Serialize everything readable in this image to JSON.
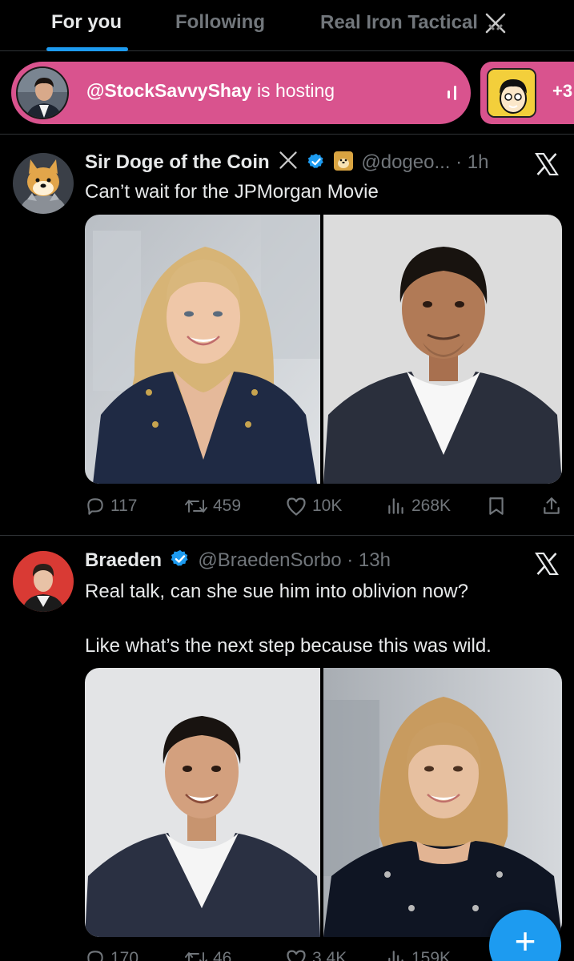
{
  "tabs": [
    {
      "label": "For you",
      "active": true
    },
    {
      "label": "Following",
      "active": false
    },
    {
      "label": "Real Iron Tactical",
      "active": false
    }
  ],
  "spaces": {
    "host_handle": "@StockSavvyShay",
    "host_suffix": "is hosting",
    "more_count": "+3"
  },
  "tweets": [
    {
      "name": "Sir Doge of the Coin",
      "handle": "@dogeo...",
      "time": "· 1h",
      "text_lines": [
        "Can’t wait for the JPMorgan Movie"
      ],
      "stats": {
        "replies": "117",
        "reposts": "459",
        "likes": "10K",
        "views": "268K"
      }
    },
    {
      "name": "Braeden",
      "handle": "@BraedenSorbo",
      "time": "· 13h",
      "text_lines": [
        "Real talk, can she sue him into oblivion now?",
        "Like what’s the next step because this was wild."
      ],
      "stats": {
        "replies": "170",
        "reposts": "46",
        "likes": "3.4K",
        "views": "159K"
      }
    }
  ],
  "fab": {
    "label": "+"
  },
  "colors": {
    "accent": "#1d9bf0",
    "space_pink": "#d9538e",
    "muted": "#71767b",
    "text": "#e7e9ea",
    "border": "#2f3336"
  },
  "icons": [
    "crossed-swords-icon",
    "verified-badge-icon",
    "doge-emoji-icon",
    "x-logo-icon",
    "reply-icon",
    "repost-icon",
    "like-icon",
    "views-icon",
    "bookmark-icon",
    "share-icon",
    "audio-bars-icon"
  ]
}
